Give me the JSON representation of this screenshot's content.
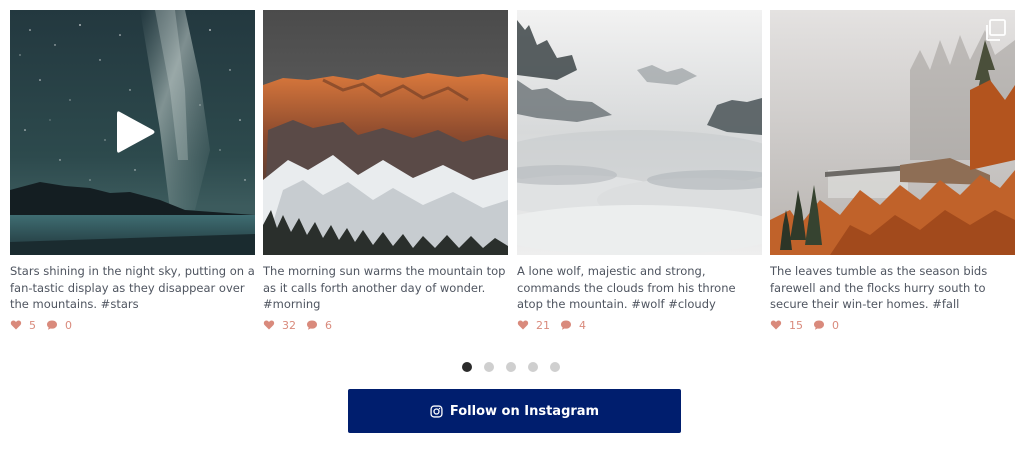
{
  "feed": {
    "posts": [
      {
        "caption": "Stars shining in the night sky, putting on a fan-tastic display as they disappear over the mountains. #stars",
        "likes": "5",
        "comments": "0",
        "media_type": "video",
        "image": "night-sky-milky-way"
      },
      {
        "caption": "The morning sun warms the mountain top as it calls forth another day of wonder. #morning",
        "likes": "32",
        "comments": "6",
        "media_type": "image",
        "image": "sunlit-snowy-mountain"
      },
      {
        "caption": "A lone wolf, majestic and strong, commands the clouds from his throne atop the mountain. #wolf #cloudy",
        "likes": "21",
        "comments": "4",
        "media_type": "image",
        "image": "misty-forest-clouds"
      },
      {
        "caption": "The leaves tumble as the season bids farewell and the flocks hurry south to secure their win-ter homes. #fall",
        "likes": "15",
        "comments": "0",
        "media_type": "carousel",
        "image": "autumn-forest-fog"
      }
    ]
  },
  "pagination": {
    "pages": 5,
    "current": 1
  },
  "follow_button": {
    "label": "Follow on Instagram",
    "icon": "instagram-icon"
  },
  "colors": {
    "button_bg": "#001e6e",
    "stat_color": "#d98a7c",
    "dot_active": "#2b2b2b",
    "dot_inactive": "#cfcfcf"
  }
}
